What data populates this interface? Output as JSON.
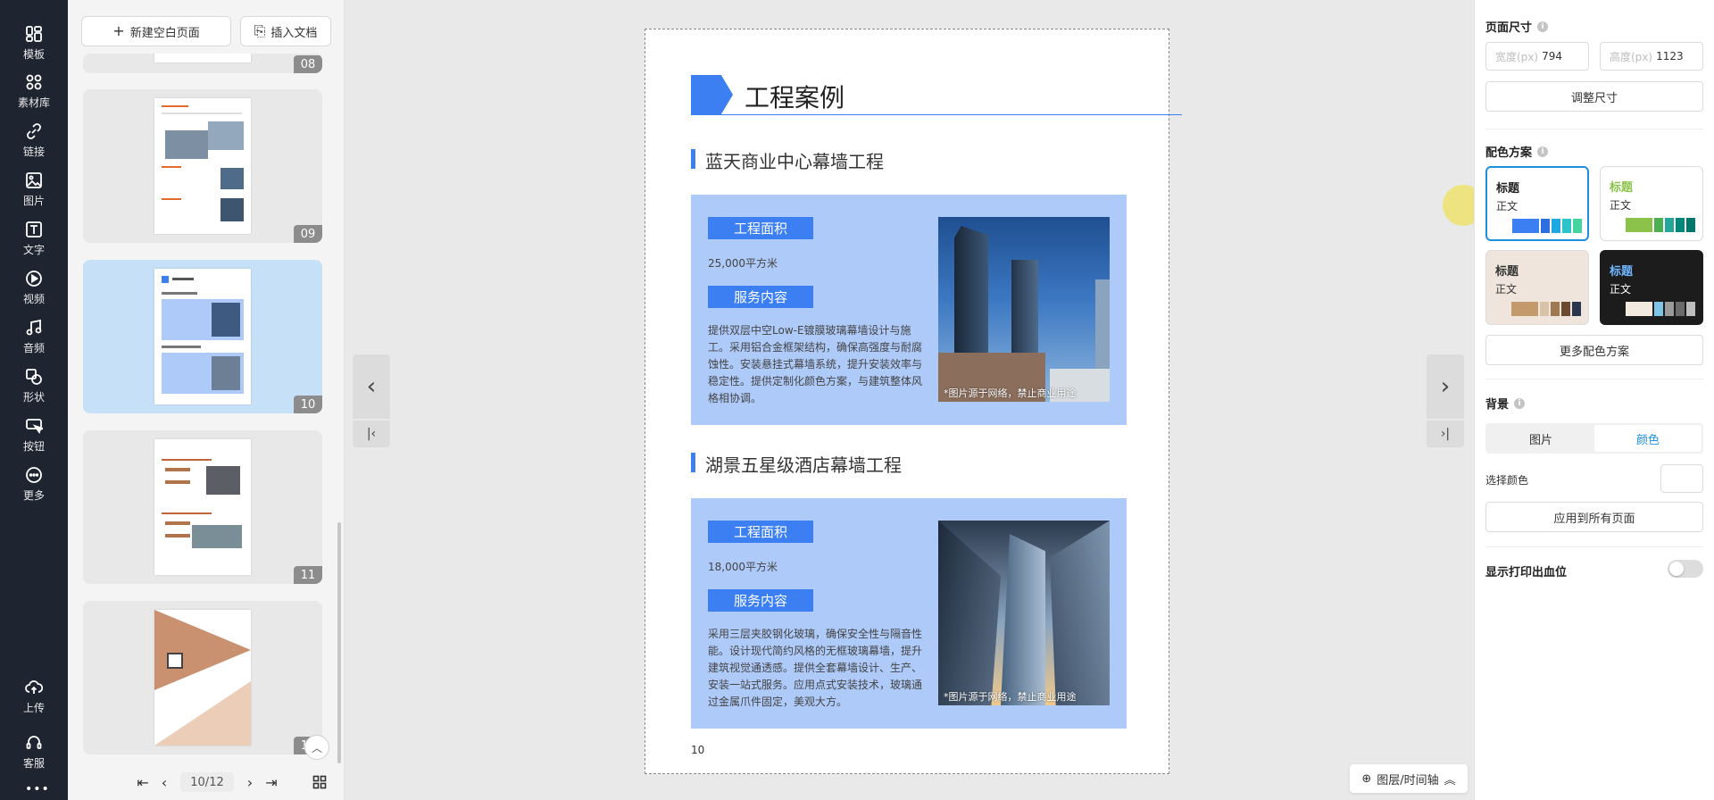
{
  "rail": {
    "items": [
      {
        "label": "模板",
        "icon": "template-icon"
      },
      {
        "label": "素材库",
        "icon": "grid-icon"
      },
      {
        "label": "链接",
        "icon": "link-icon"
      },
      {
        "label": "图片",
        "icon": "image-icon"
      },
      {
        "label": "文字",
        "icon": "text-icon"
      },
      {
        "label": "视频",
        "icon": "video-icon"
      },
      {
        "label": "音频",
        "icon": "music-icon"
      },
      {
        "label": "形状",
        "icon": "shape-icon"
      },
      {
        "label": "按钮",
        "icon": "button-icon"
      },
      {
        "label": "更多",
        "icon": "more-icon"
      }
    ],
    "upload": "上传",
    "service": "客服"
  },
  "thumbs": {
    "new_page": "新建空白页面",
    "insert_doc": "插入文档",
    "pages": [
      "08",
      "09",
      "10",
      "11",
      "12"
    ],
    "pager_value": "10/12"
  },
  "page": {
    "title": "工程案例",
    "cases": [
      {
        "title": "蓝天商业中心幕墙工程",
        "area_label": "工程面积",
        "area_value": "25,000平方米",
        "service_label": "服务内容",
        "desc": "提供双层中空Low-E镀膜玻璃幕墙设计与施工。采用铝合金框架结构，确保高强度与耐腐蚀性。安装悬挂式幕墙系统，提升安装效率与稳定性。提供定制化颜色方案，与建筑整体风格相协调。",
        "photo_caption": "*图片源于网络，禁止商业用途"
      },
      {
        "title": "湖景五星级酒店幕墙工程",
        "area_label": "工程面积",
        "area_value": "18,000平方米",
        "service_label": "服务内容",
        "desc": "采用三层夹胶钢化玻璃，确保安全性与隔音性能。设计现代简约风格的无框玻璃幕墙，提升建筑视觉通透感。提供全套幕墙设计、生产、安装一站式服务。应用点式安装技术，玻璃通过金属爪件固定，美观大方。",
        "photo_caption": "*图片源于网络，禁止商业用途"
      }
    ],
    "page_number": "10"
  },
  "canvas": {
    "layers_button": "图层/时间轴"
  },
  "right": {
    "page_size_title": "页面尺寸",
    "width_placeholder": "宽度(px)",
    "width_value": "794",
    "height_placeholder": "高度(px)",
    "height_value": "1123",
    "resize_button": "调整尺寸",
    "scheme_title": "配色方案",
    "schemes": [
      {
        "title": "标题",
        "body": "正文",
        "title_color": "#222222",
        "body_color": "#333333",
        "bg": "#ffffff",
        "swatches": [
          "#3b7ff2",
          "#2f6ee0",
          "#1ea7e0",
          "#2cc4c9",
          "#45d3a0"
        ]
      },
      {
        "title": "标题",
        "body": "正文",
        "title_color": "#8bc34a",
        "body_color": "#333333",
        "bg": "#ffffff",
        "swatches": [
          "#8bc34a",
          "#4caf50",
          "#26a69a",
          "#00897b",
          "#00796b"
        ]
      },
      {
        "title": "标题",
        "body": "正文",
        "title_color": "#333333",
        "body_color": "#333333",
        "bg": "#efe5dc",
        "swatches": [
          "#c39a6b",
          "#d9c3a8",
          "#a07850",
          "#6b4a30",
          "#2a3550"
        ]
      },
      {
        "title": "标题",
        "body": "正文",
        "title_color": "#6fb7ff",
        "body_color": "#ffffff",
        "bg": "#1c1c1c",
        "swatches": [
          "#f2eadf",
          "#7ec3e8",
          "#9a9a9a",
          "#6a6a6a",
          "#bdbdbd"
        ]
      }
    ],
    "more_schemes": "更多配色方案",
    "bg_title": "背景",
    "bg_tab_image": "图片",
    "bg_tab_color": "颜色",
    "pick_color": "选择颜色",
    "apply_all": "应用到所有页面",
    "bleed_label": "显示打印出血位"
  }
}
